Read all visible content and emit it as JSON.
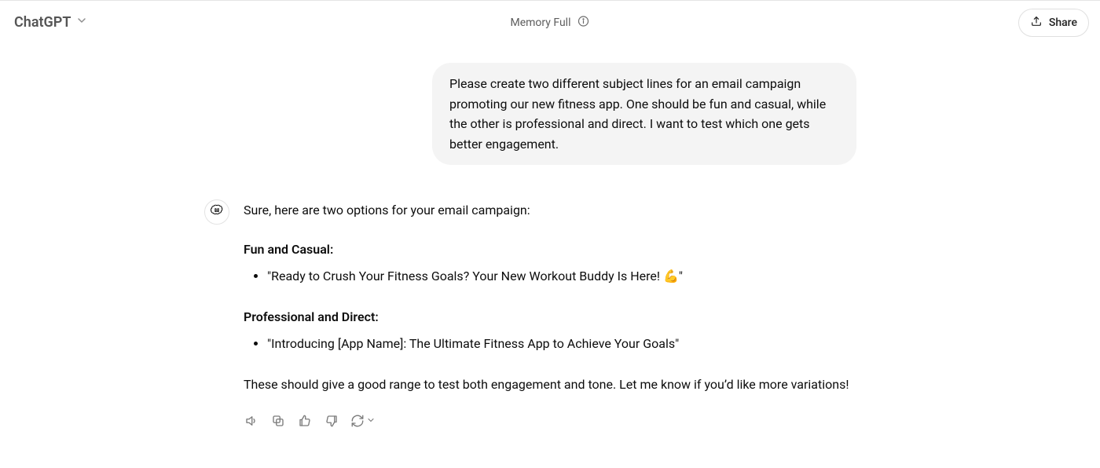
{
  "header": {
    "model_label": "ChatGPT",
    "status_text": "Memory Full",
    "share_label": "Share"
  },
  "conversation": {
    "user_message": "Please create two different subject lines for an email campaign promoting our new fitness app. One should be fun and casual, while the other is professional and direct. I want to test which one gets better engagement.",
    "assistant": {
      "intro": "Sure, here are two options for your email campaign:",
      "section1_title": "Fun and Casual:",
      "section1_item": "\"Ready to Crush Your Fitness Goals? Your New Workout Buddy Is Here! 💪\"",
      "section2_title": "Professional and Direct:",
      "section2_item": "\"Introducing [App Name]: The Ultimate Fitness App to Achieve Your Goals\"",
      "closing": "These should give a good range to test both engagement and tone. Let me know if you’d like more variations!"
    }
  }
}
